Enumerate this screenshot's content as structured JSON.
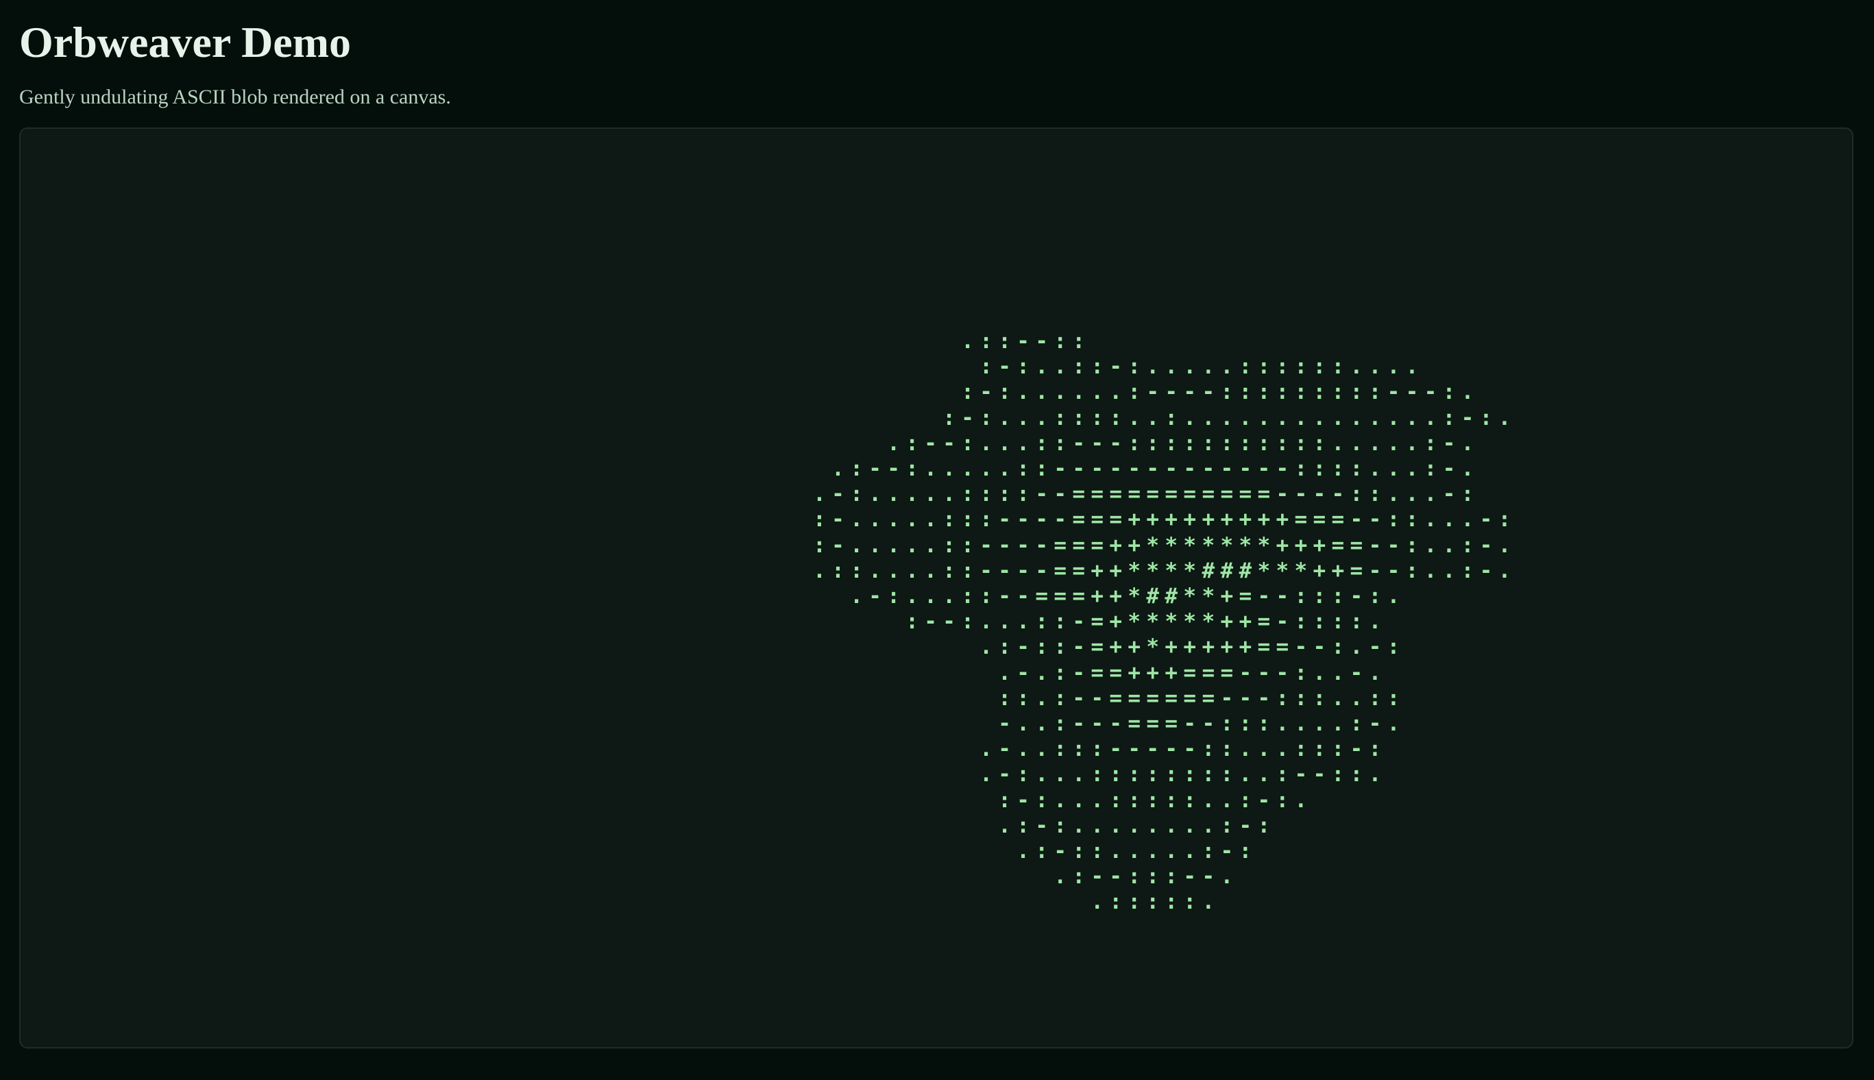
{
  "header": {
    "title": "Orbweaver Demo",
    "subtitle": "Gently undulating ASCII blob rendered on a canvas."
  },
  "canvas": {
    "ascii_lines": [
      "                    .::--::",
      "                     :-:..::-:.....::::::....",
      "                    :-:......:----:::::::::---:.",
      "                   :-:...::::..:..............:-:.",
      "                .:--:...::---:::::::::::.....:-.",
      "             .:--:.....::-------------::::...:-.",
      "            .-:.....::::--===========----::...-:",
      "            :-.....:::----===+++++++++===--::...-:",
      "            :-.....::----===++*******+++==--:..:-.",
      "            .::....::----==++****###***++=--:..:-.",
      "              .-:...::--===++*##**+=--:::-:.",
      "                 :--:...::-=+*****++=-::::.",
      "                     .:-::-=++*+++++==--:.-:",
      "                      .-.:-==+++===---:..-.",
      "                      ::.:--======---:::..::",
      "                      -..:---===--:::....:-.",
      "                     .-..:::-----::...:::-:",
      "                     .-:...::::::::..:--::.",
      "                      :-:...:::::..:-:.",
      "                      .:-:........:-:",
      "                       .:-::.....:-:",
      "                         .:--:::--.",
      "                           .:::::."
    ],
    "colors": {
      "page_background": "#040f0c",
      "canvas_background": "#0e1814",
      "canvas_border": "#1e2d27",
      "ascii_glyph": "#9ee6a6",
      "title_text": "#e6f3ea",
      "subtitle_text": "#b9d4c3"
    }
  }
}
